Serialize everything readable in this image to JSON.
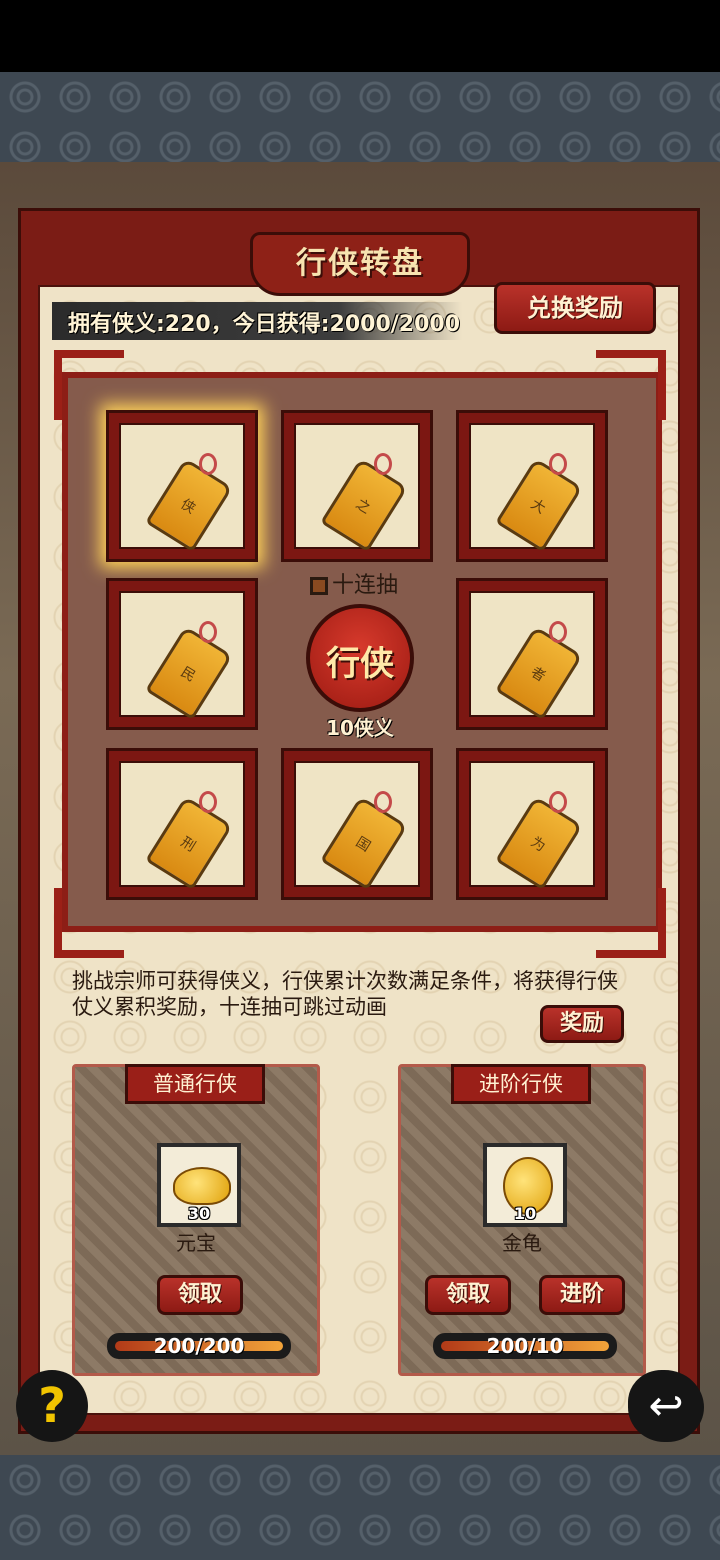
{
  "title": "行侠转盘",
  "stats": {
    "text": "拥有侠义:220，今日获得:2000/2000"
  },
  "exchange_button": "兑换奖励",
  "grid": {
    "cells": [
      {
        "char": "侠"
      },
      {
        "char": "之"
      },
      {
        "char": "大"
      },
      {
        "char": "民"
      },
      {
        "char": "者"
      },
      {
        "char": "刑"
      },
      {
        "char": "国"
      },
      {
        "char": "为"
      }
    ],
    "ten_draw_label": "十连抽",
    "draw_button": "行侠",
    "draw_cost": "10侠义"
  },
  "description": "挑战宗师可获得侠义，行侠累计次数满足条件，将获得行侠仗义累积奖励，十连抽可跳过动画",
  "reward_button": "奖励",
  "cards": {
    "normal": {
      "title": "普通行侠",
      "item_name": "元宝",
      "item_count": "30",
      "claim_label": "领取",
      "progress_text": "200/200",
      "progress": 1.0
    },
    "advanced": {
      "title": "进阶行侠",
      "item_name": "金龟",
      "item_count": "10",
      "claim_label": "领取",
      "advance_label": "进阶",
      "progress_text": "200/10",
      "progress": 1.0
    }
  },
  "help_glyph": "?",
  "back_glyph": "↩"
}
